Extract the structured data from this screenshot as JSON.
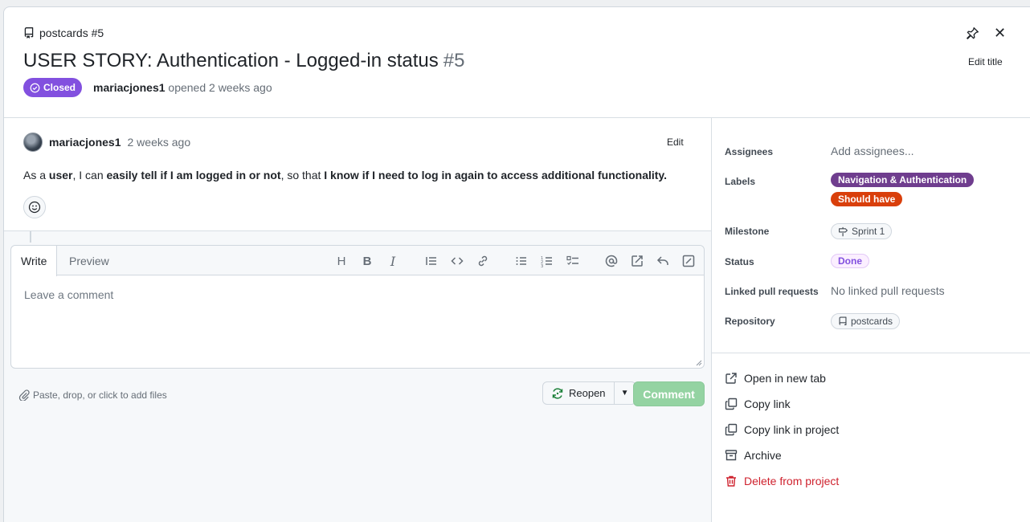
{
  "header": {
    "repo_ref": "postcards #5",
    "title": "USER STORY: Authentication - Logged-in status",
    "number": "#5",
    "state": "Closed",
    "author": "mariacjones1",
    "opened_text": "opened 2 weeks ago",
    "edit_title_label": "Edit title"
  },
  "comment": {
    "author": "mariacjones1",
    "time": "2 weeks ago",
    "edit_label": "Edit",
    "body": [
      {
        "t": "As a ",
        "strong": false
      },
      {
        "t": "user",
        "strong": true
      },
      {
        "t": ", I can ",
        "strong": false
      },
      {
        "t": "easily tell if I am logged in or not",
        "strong": true
      },
      {
        "t": ", so that ",
        "strong": false
      },
      {
        "t": "I know if I need to log in again to access additional functionality.",
        "strong": true
      }
    ]
  },
  "editor": {
    "tabs": [
      "Write",
      "Preview"
    ],
    "placeholder": "Leave a comment",
    "attach_text": "Paste, drop, or click to add files",
    "reopen_label": "Reopen",
    "comment_label": "Comment"
  },
  "sidebar": {
    "assignees_label": "Assignees",
    "assignees_value": "Add assignees...",
    "labels_label": "Labels",
    "labels": [
      {
        "name": "Navigation & Authentication",
        "color": "#6f3d8e"
      },
      {
        "name": "Should have",
        "color": "#d93f0b"
      }
    ],
    "milestone_label": "Milestone",
    "milestone_value": "Sprint 1",
    "status_label": "Status",
    "status_value": "Done",
    "linked_label": "Linked pull requests",
    "linked_value": "No linked pull requests",
    "repository_label": "Repository",
    "repository_value": "postcards"
  },
  "actions": {
    "open_new_tab": "Open in new tab",
    "copy_link": "Copy link",
    "copy_link_project": "Copy link in project",
    "archive": "Archive",
    "delete": "Delete from project"
  },
  "colors": {
    "closed": "#8250df",
    "comment_disabled": "#94d3a2",
    "danger": "#cf222e"
  }
}
